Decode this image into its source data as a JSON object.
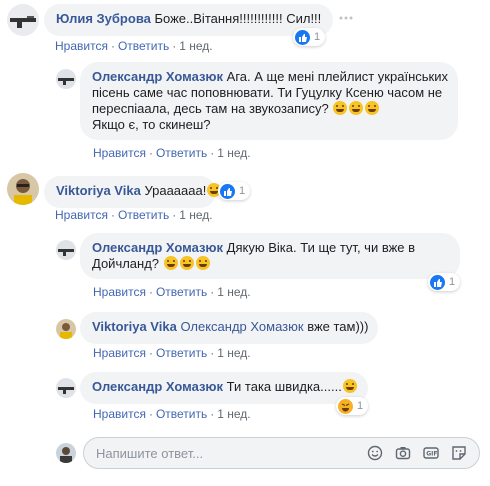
{
  "comments": [
    {
      "author": "Юлия Зуброва",
      "text": "Боже..Вітання!!!!!!!!!!!! Сил!!!",
      "like": "Нравится",
      "reply": "Ответить",
      "time": "1 нед.",
      "reaction_count": "1"
    },
    {
      "author": "Олександр Хомазюк",
      "text_line1": "Ага. А ще мені плейлист українських",
      "text_line2": "пісень саме час поповнювати. Ти Гуцулку Ксеню часом не",
      "text_line3": "переспіаала, десь там на звукозапису?",
      "text_line4": "Якщо є, то скинеш?",
      "like": "Нравится",
      "reply": "Ответить",
      "time": "1 нед."
    },
    {
      "author": "Viktoriya Vika",
      "text": "Ураааааа!",
      "like": "Нравится",
      "reply": "Ответить",
      "time": "1 нед.",
      "reaction_count": "1"
    },
    {
      "author": "Олександр Хомазюк",
      "text_line1": "Дякую Віка. Ти ще тут, чи вже в",
      "text_line2": "Дойчланд?",
      "like": "Нравится",
      "reply": "Ответить",
      "time": "1 нед.",
      "reaction_count": "1"
    },
    {
      "author": "Viktoriya Vika",
      "mention": "Олександр Хомазюк",
      "text": "вже там)))",
      "like": "Нравится",
      "reply": "Ответить",
      "time": "1 нед."
    },
    {
      "author": "Олександр Хомазюк",
      "text": "Ти така швидка......",
      "like": "Нравится",
      "reply": "Ответить",
      "time": "1 нед.",
      "reaction_count": "1"
    }
  ],
  "composer": {
    "placeholder": "Напишите ответ..."
  },
  "colors": {
    "link": "#385898",
    "bubble": "#f2f3f5",
    "like_blue": "#1877f2",
    "haha_yellow": "#f7b125"
  },
  "icons": [
    "more-options-icon",
    "like-reaction-icon",
    "haha-reaction-icon",
    "smiley-emoji-icon",
    "camera-icon",
    "gif-icon",
    "sticker-icon"
  ]
}
